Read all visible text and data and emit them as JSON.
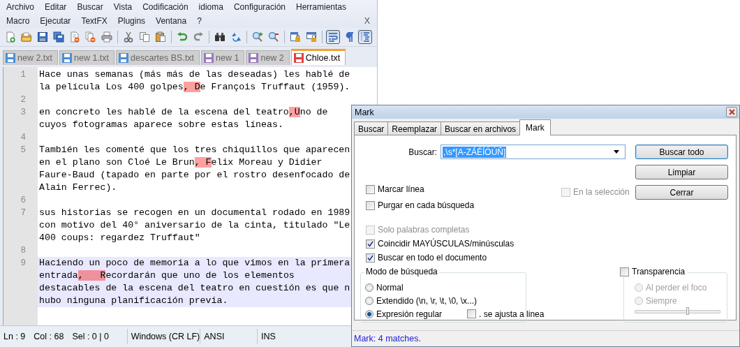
{
  "menu_rows": [
    [
      "Archivo",
      "Editar",
      "Buscar",
      "Vista",
      "Codificación",
      "idioma",
      "Configuración",
      "Herramientas"
    ],
    [
      "Macro",
      "Ejecutar",
      "TextFX",
      "Plugins",
      "Ventana",
      "?"
    ]
  ],
  "menu_close": "X",
  "toolbar_groups": [
    [
      {
        "kind": "new",
        "pressed": false
      },
      {
        "kind": "open",
        "pressed": false
      },
      {
        "kind": "save",
        "pressed": false
      },
      {
        "kind": "save-all",
        "pressed": false
      },
      {
        "kind": "close",
        "pressed": false
      },
      {
        "kind": "close-all",
        "pressed": false
      },
      {
        "kind": "print",
        "pressed": false
      }
    ],
    [
      {
        "kind": "cut",
        "pressed": false
      },
      {
        "kind": "copy",
        "pressed": false
      },
      {
        "kind": "paste",
        "pressed": false
      }
    ],
    [
      {
        "kind": "undo",
        "pressed": false
      },
      {
        "kind": "redo",
        "pressed": false
      }
    ],
    [
      {
        "kind": "find",
        "pressed": false
      },
      {
        "kind": "replace",
        "pressed": false
      }
    ],
    [
      {
        "kind": "zoom-in",
        "pressed": false
      },
      {
        "kind": "zoom-out",
        "pressed": false
      }
    ],
    [
      {
        "kind": "sync-v",
        "pressed": false
      },
      {
        "kind": "sync-h",
        "pressed": false
      }
    ],
    [
      {
        "kind": "wrap",
        "pressed": true
      },
      {
        "kind": "all-chars",
        "pressed": false
      },
      {
        "kind": "indent-guide",
        "pressed": true
      }
    ]
  ],
  "tabs": [
    {
      "label": "new 2.txt",
      "selected": false,
      "color": "#4a8ed8"
    },
    {
      "label": "new 1.txt",
      "selected": false,
      "color": "#4a8ed8"
    },
    {
      "label": "descartes BS.txt",
      "selected": false,
      "color": "#4a8ed8"
    },
    {
      "label": "new 1",
      "selected": false,
      "color": "#9a78c0"
    },
    {
      "label": "new 2",
      "selected": false,
      "color": "#9a78c0"
    },
    {
      "label": "Chloe.txt",
      "selected": true,
      "color": "#e04040"
    }
  ],
  "editor": {
    "lines": [
      {
        "number": "1",
        "current": false,
        "rows": [
          [
            {
              "text": "Hace unas semanas (más más de las deseadas) les hablé de",
              "marked": false
            }
          ],
          [
            {
              "text": "la película Los 400 golpes",
              "marked": false
            },
            {
              "text": ", D",
              "marked": true
            },
            {
              "text": "e François Truffaut (1959).",
              "marked": false
            }
          ]
        ]
      },
      {
        "number": "2",
        "current": false
      },
      {
        "number": "3",
        "current": false,
        "rows": [
          [
            {
              "text": "en concreto les hablé de la escena del teatro",
              "marked": false
            },
            {
              "text": ",U",
              "marked": true
            },
            {
              "text": "no de",
              "marked": false
            }
          ],
          [
            {
              "text": "cuyos fotogramas aparece sobre estas líneas.",
              "marked": false
            }
          ]
        ]
      },
      {
        "number": "4",
        "current": false
      },
      {
        "number": "5",
        "current": false,
        "rows": [
          [
            {
              "text": "También les comenté que los tres chiquillos que aparecen",
              "marked": false
            }
          ],
          [
            {
              "text": "en el plano son Cloé Le Brun",
              "marked": false
            },
            {
              "text": ", F",
              "marked": true
            },
            {
              "text": "elix Moreau y Didier",
              "marked": false
            }
          ],
          [
            {
              "text": "Faure-Baud (tapado en parte por el rostro desenfocado de",
              "marked": false
            }
          ],
          [
            {
              "text": "Alain Ferrec).",
              "marked": false
            }
          ]
        ]
      },
      {
        "number": "6",
        "current": false
      },
      {
        "number": "7",
        "current": false,
        "rows": [
          [
            {
              "text": "sus historias se recogen en un documental rodado en 1989",
              "marked": false
            }
          ],
          [
            {
              "text": "con motivo del 40° aniversario de la cinta, titulado \"Le",
              "marked": false
            }
          ],
          [
            {
              "text": "400 coups: regardez Truffaut\"",
              "marked": false
            }
          ]
        ]
      },
      {
        "number": "8",
        "current": false
      },
      {
        "number": "9",
        "current": true,
        "rows": [
          [
            {
              "text": "Haciendo un poco de memoria a lo que vimos en la primera",
              "marked": false
            }
          ],
          [
            {
              "text": "entrada",
              "marked": false
            },
            {
              "text": ",   R",
              "marked": true
            },
            {
              "text": "ecordarán que uno de los elementos",
              "marked": false
            }
          ],
          [
            {
              "text": "destacables de la escena del teatro en cuestión es que n",
              "marked": false
            }
          ],
          [
            {
              "text": "hubo ninguna planificación previa.",
              "marked": false
            }
          ]
        ]
      }
    ]
  },
  "status_bar": {
    "fields": [
      "Ln : 9",
      "Col : 68",
      "Sel : 0 | 0"
    ],
    "eol": "Windows (CR LF)",
    "encoding": "ANSI",
    "mode": "INS"
  },
  "dialog": {
    "title": "Mark",
    "tabs": [
      {
        "label": "Buscar",
        "selected": false
      },
      {
        "label": "Reemplazar",
        "selected": false
      },
      {
        "label": "Buscar en archivos",
        "selected": false
      },
      {
        "label": "Mark",
        "selected": true
      }
    ],
    "search_label": "Buscar:",
    "search_value": ",\\s*[A-ZÁÉÍÓÚÑ]",
    "search_value_selected": true,
    "buttons": [
      {
        "label": "Buscar todo",
        "default": true
      },
      {
        "label": "Limpiar",
        "default": false
      },
      {
        "label": "Cerrar",
        "default": false
      }
    ],
    "options": [
      {
        "label": "Marcar línea",
        "checked": false,
        "disabled": false
      },
      {
        "label": "Purgar en cada búsqueda",
        "checked": false,
        "disabled": false
      }
    ],
    "in_selection": {
      "label": "En la selección",
      "checked": false,
      "disabled": true
    },
    "match_options": [
      {
        "label": "Solo palabras completas",
        "checked": false,
        "disabled": true
      },
      {
        "label": "Coincidir MAYÚSCULAS/minúsculas",
        "checked": true,
        "disabled": false
      },
      {
        "label": "Buscar en todo el documento",
        "checked": true,
        "disabled": false
      }
    ],
    "search_mode": {
      "title": "Modo de búsqueda",
      "modes": [
        {
          "label": "Normal",
          "selected": false
        },
        {
          "label": "Extendido (\\n, \\r, \\t, \\0, \\x...)",
          "selected": false
        },
        {
          "label": "Expresión regular",
          "selected": true
        }
      ],
      "dot_newline": {
        "label": ". se ajusta a linea",
        "checked": false
      }
    },
    "transparency": {
      "label": "Transparencia",
      "checked": false,
      "modes": [
        {
          "label": "Al perder el foco",
          "selected": false
        },
        {
          "label": "Siempre",
          "selected": false
        }
      ],
      "level": 0.62
    },
    "status": "Mark: 4 matches."
  }
}
